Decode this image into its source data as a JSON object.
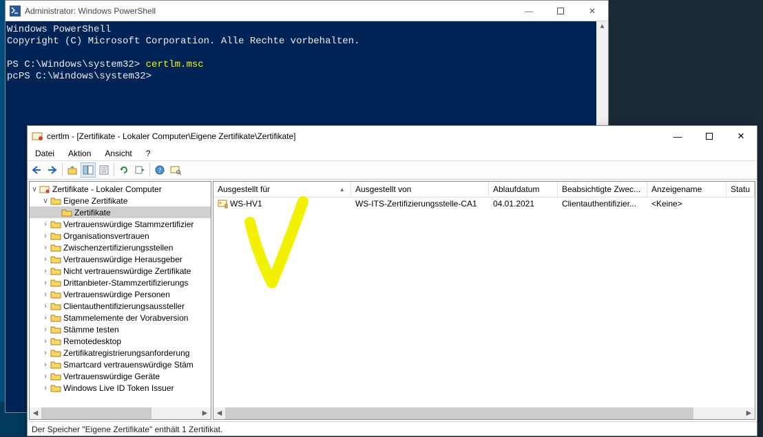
{
  "powershell": {
    "title": "Administrator: Windows PowerShell",
    "lines": {
      "l1": "Windows PowerShell",
      "l2": "Copyright (C) Microsoft Corporation. Alle Rechte vorbehalten.",
      "l3_prompt": "PS C:\\Windows\\system32> ",
      "l3_cmd": "certlm.msc",
      "l4_prefix": "pc",
      "l4_prompt": "PS C:\\Windows\\system32>"
    }
  },
  "mmc": {
    "title": "certlm - [Zertifikate - Lokaler Computer\\Eigene Zertifikate\\Zertifikate]",
    "menu": {
      "file": "Datei",
      "action": "Aktion",
      "view": "Ansicht",
      "help": "?"
    },
    "tree": {
      "root": "Zertifikate - Lokaler Computer",
      "own": "Eigene Zertifikate",
      "own_certs": "Zertifikate",
      "items": [
        "Vertrauenswürdige Stammzertifizier",
        "Organisationsvertrauen",
        "Zwischenzertifizierungsstellen",
        "Vertrauenswürdige Herausgeber",
        "Nicht vertrauenswürdige Zertifikate",
        "Drittanbieter-Stammzertifizierungs",
        "Vertrauenswürdige Personen",
        "Clientauthentifizierungsaussteller",
        "Stammelemente der Vorabversion",
        "Stämme testen",
        "Remotedesktop",
        "Zertifikatregistrierungsanforderung",
        "Smartcard vertrauenswürdige Stäm",
        "Vertrauenswürdige Geräte",
        "Windows Live ID Token Issuer"
      ]
    },
    "columns": {
      "issued_to": "Ausgestellt für",
      "issued_by": "Ausgestellt von",
      "expiry": "Ablaufdatum",
      "purpose": "Beabsichtigte Zwec...",
      "friendly": "Anzeigename",
      "status": "Statu"
    },
    "row": {
      "issued_to": "WS-HV1",
      "issued_by": "WS-ITS-Zertifizierungsstelle-CA1",
      "expiry": "04.01.2021",
      "purpose": "Clientauthentifizier...",
      "friendly": "<Keine>"
    },
    "status": "Der Speicher \"Eigene Zertifikate\" enthält 1 Zertifikat."
  }
}
